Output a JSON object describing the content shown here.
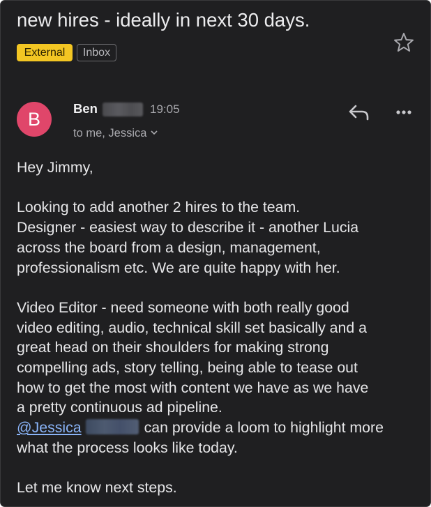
{
  "email": {
    "subject": "new hires - ideally in next 30 days.",
    "labels": {
      "external": "External",
      "inbox": "Inbox"
    },
    "sender": {
      "avatar_initial": "B",
      "name": "Ben",
      "time": "19:05",
      "recipients": "to me, Jessica"
    },
    "body": {
      "greeting": "Hey Jimmy,",
      "p1": [
        "Looking to add another 2 hires to the team.",
        "Designer - easiest way to describe it - another Lucia",
        "across the board from a design, management,",
        "professionalism etc. We are quite happy with her."
      ],
      "p2": [
        "Video Editor - need someone with both really good",
        "video editing, audio, technical skill set basically and a",
        "great head on their shoulders for making strong",
        "compelling ads, story telling, being able to tease out",
        "how to get the most with content we have as we have",
        "a pretty continuous ad pipeline."
      ],
      "mention": "@Jessica",
      "after_mention": "can provide a loom to highlight more",
      "p3_last": "what the process looks like today.",
      "closing": "Let me know next steps."
    }
  },
  "icons": {
    "star": "star-outline-icon",
    "reply": "reply-arrow-icon",
    "more": "more-horizontal-icon",
    "chevron": "chevron-down-icon"
  },
  "colors": {
    "background": "#1f1f21",
    "external_chip": "#f3c623",
    "avatar": "#e0466a",
    "mention_link": "#8ab4f8"
  }
}
